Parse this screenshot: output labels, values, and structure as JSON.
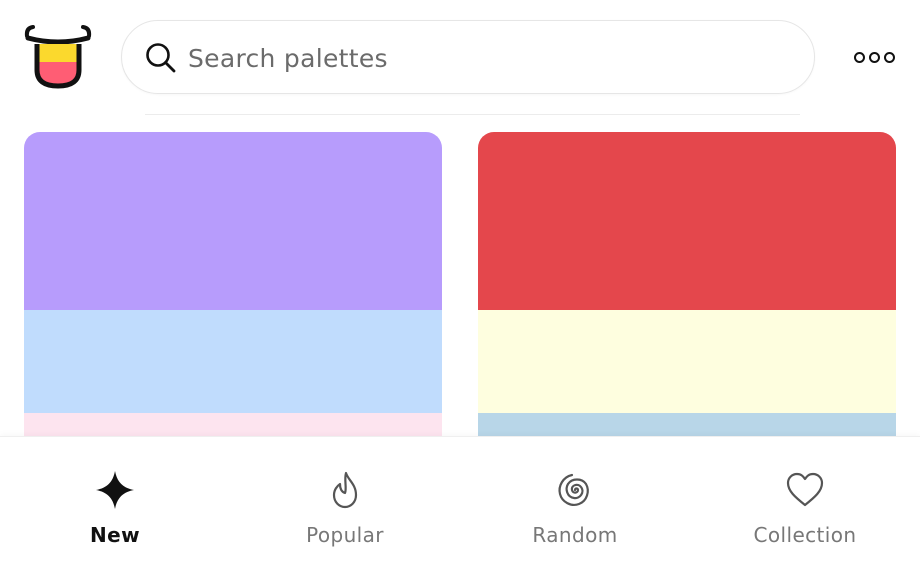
{
  "header": {
    "logo": "tongue-face-logo",
    "search": {
      "placeholder": "Search palettes",
      "value": "",
      "icon": "search-icon"
    },
    "more_icon": "more-dots-icon"
  },
  "palettes": [
    {
      "colors": [
        "#b79cfc",
        "#c0dcfd",
        "#fde4ef"
      ]
    },
    {
      "colors": [
        "#e4474c",
        "#fefedf",
        "#b8d6e8"
      ]
    }
  ],
  "bottom_nav": {
    "active": "New",
    "items": [
      {
        "label": "New",
        "icon": "sparkle-icon"
      },
      {
        "label": "Popular",
        "icon": "flame-icon"
      },
      {
        "label": "Random",
        "icon": "spiral-icon"
      },
      {
        "label": "Collection",
        "icon": "heart-icon"
      }
    ]
  },
  "colors": {
    "logo_yellow": "#fbd92d",
    "logo_pink": "#ff5d74",
    "text_active": "#111111",
    "text_inactive": "#777777"
  }
}
